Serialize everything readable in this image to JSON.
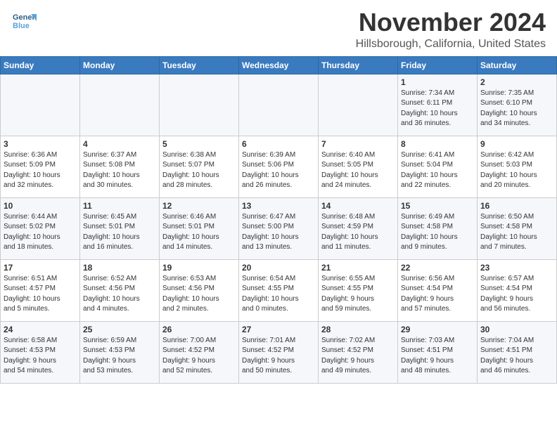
{
  "header": {
    "logo_line1": "General",
    "logo_line2": "Blue",
    "month": "November 2024",
    "location": "Hillsborough, California, United States"
  },
  "weekdays": [
    "Sunday",
    "Monday",
    "Tuesday",
    "Wednesday",
    "Thursday",
    "Friday",
    "Saturday"
  ],
  "weeks": [
    [
      {
        "day": "",
        "info": ""
      },
      {
        "day": "",
        "info": ""
      },
      {
        "day": "",
        "info": ""
      },
      {
        "day": "",
        "info": ""
      },
      {
        "day": "",
        "info": ""
      },
      {
        "day": "1",
        "info": "Sunrise: 7:34 AM\nSunset: 6:11 PM\nDaylight: 10 hours\nand 36 minutes."
      },
      {
        "day": "2",
        "info": "Sunrise: 7:35 AM\nSunset: 6:10 PM\nDaylight: 10 hours\nand 34 minutes."
      }
    ],
    [
      {
        "day": "3",
        "info": "Sunrise: 6:36 AM\nSunset: 5:09 PM\nDaylight: 10 hours\nand 32 minutes."
      },
      {
        "day": "4",
        "info": "Sunrise: 6:37 AM\nSunset: 5:08 PM\nDaylight: 10 hours\nand 30 minutes."
      },
      {
        "day": "5",
        "info": "Sunrise: 6:38 AM\nSunset: 5:07 PM\nDaylight: 10 hours\nand 28 minutes."
      },
      {
        "day": "6",
        "info": "Sunrise: 6:39 AM\nSunset: 5:06 PM\nDaylight: 10 hours\nand 26 minutes."
      },
      {
        "day": "7",
        "info": "Sunrise: 6:40 AM\nSunset: 5:05 PM\nDaylight: 10 hours\nand 24 minutes."
      },
      {
        "day": "8",
        "info": "Sunrise: 6:41 AM\nSunset: 5:04 PM\nDaylight: 10 hours\nand 22 minutes."
      },
      {
        "day": "9",
        "info": "Sunrise: 6:42 AM\nSunset: 5:03 PM\nDaylight: 10 hours\nand 20 minutes."
      }
    ],
    [
      {
        "day": "10",
        "info": "Sunrise: 6:44 AM\nSunset: 5:02 PM\nDaylight: 10 hours\nand 18 minutes."
      },
      {
        "day": "11",
        "info": "Sunrise: 6:45 AM\nSunset: 5:01 PM\nDaylight: 10 hours\nand 16 minutes."
      },
      {
        "day": "12",
        "info": "Sunrise: 6:46 AM\nSunset: 5:01 PM\nDaylight: 10 hours\nand 14 minutes."
      },
      {
        "day": "13",
        "info": "Sunrise: 6:47 AM\nSunset: 5:00 PM\nDaylight: 10 hours\nand 13 minutes."
      },
      {
        "day": "14",
        "info": "Sunrise: 6:48 AM\nSunset: 4:59 PM\nDaylight: 10 hours\nand 11 minutes."
      },
      {
        "day": "15",
        "info": "Sunrise: 6:49 AM\nSunset: 4:58 PM\nDaylight: 10 hours\nand 9 minutes."
      },
      {
        "day": "16",
        "info": "Sunrise: 6:50 AM\nSunset: 4:58 PM\nDaylight: 10 hours\nand 7 minutes."
      }
    ],
    [
      {
        "day": "17",
        "info": "Sunrise: 6:51 AM\nSunset: 4:57 PM\nDaylight: 10 hours\nand 5 minutes."
      },
      {
        "day": "18",
        "info": "Sunrise: 6:52 AM\nSunset: 4:56 PM\nDaylight: 10 hours\nand 4 minutes."
      },
      {
        "day": "19",
        "info": "Sunrise: 6:53 AM\nSunset: 4:56 PM\nDaylight: 10 hours\nand 2 minutes."
      },
      {
        "day": "20",
        "info": "Sunrise: 6:54 AM\nSunset: 4:55 PM\nDaylight: 10 hours\nand 0 minutes."
      },
      {
        "day": "21",
        "info": "Sunrise: 6:55 AM\nSunset: 4:55 PM\nDaylight: 9 hours\nand 59 minutes."
      },
      {
        "day": "22",
        "info": "Sunrise: 6:56 AM\nSunset: 4:54 PM\nDaylight: 9 hours\nand 57 minutes."
      },
      {
        "day": "23",
        "info": "Sunrise: 6:57 AM\nSunset: 4:54 PM\nDaylight: 9 hours\nand 56 minutes."
      }
    ],
    [
      {
        "day": "24",
        "info": "Sunrise: 6:58 AM\nSunset: 4:53 PM\nDaylight: 9 hours\nand 54 minutes."
      },
      {
        "day": "25",
        "info": "Sunrise: 6:59 AM\nSunset: 4:53 PM\nDaylight: 9 hours\nand 53 minutes."
      },
      {
        "day": "26",
        "info": "Sunrise: 7:00 AM\nSunset: 4:52 PM\nDaylight: 9 hours\nand 52 minutes."
      },
      {
        "day": "27",
        "info": "Sunrise: 7:01 AM\nSunset: 4:52 PM\nDaylight: 9 hours\nand 50 minutes."
      },
      {
        "day": "28",
        "info": "Sunrise: 7:02 AM\nSunset: 4:52 PM\nDaylight: 9 hours\nand 49 minutes."
      },
      {
        "day": "29",
        "info": "Sunrise: 7:03 AM\nSunset: 4:51 PM\nDaylight: 9 hours\nand 48 minutes."
      },
      {
        "day": "30",
        "info": "Sunrise: 7:04 AM\nSunset: 4:51 PM\nDaylight: 9 hours\nand 46 minutes."
      }
    ]
  ]
}
